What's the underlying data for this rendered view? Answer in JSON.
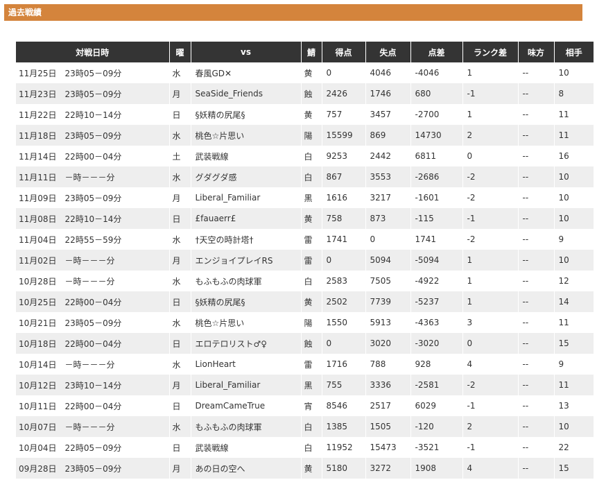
{
  "header": {
    "title": "過去戦績"
  },
  "columns": [
    "対戦日時",
    "曜",
    "vs",
    "鯖",
    "得点",
    "失点",
    "点差",
    "ランク差",
    "味方",
    "相手"
  ],
  "rows": [
    {
      "date": "11月25日",
      "time": "23時05－09分",
      "day": "水",
      "vs": "春風GD✕",
      "zoku": "黄",
      "score": "0",
      "lost": "4046",
      "diff": "-4046",
      "rank": "1",
      "mikata": "--",
      "aite": "10"
    },
    {
      "date": "11月23日",
      "time": "23時05－09分",
      "day": "月",
      "vs": "SeaSide_Friends",
      "zoku": "蝕",
      "score": "2426",
      "lost": "1746",
      "diff": "680",
      "rank": "-1",
      "mikata": "--",
      "aite": "8"
    },
    {
      "date": "11月22日",
      "time": "22時10－14分",
      "day": "日",
      "vs": "§妖精の尻尾§",
      "zoku": "黄",
      "score": "757",
      "lost": "3457",
      "diff": "-2700",
      "rank": "1",
      "mikata": "--",
      "aite": "11"
    },
    {
      "date": "11月18日",
      "time": "23時05－09分",
      "day": "水",
      "vs": "桃色☆片思い",
      "zoku": "陽",
      "score": "15599",
      "lost": "869",
      "diff": "14730",
      "rank": "2",
      "mikata": "--",
      "aite": "11"
    },
    {
      "date": "11月14日",
      "time": "22時00－04分",
      "day": "土",
      "vs": "武装戦線",
      "zoku": "白",
      "score": "9253",
      "lost": "2442",
      "diff": "6811",
      "rank": "0",
      "mikata": "--",
      "aite": "16"
    },
    {
      "date": "11月11日",
      "time": "－時－－－分",
      "day": "水",
      "vs": "グダグダ感",
      "zoku": "白",
      "score": "867",
      "lost": "3553",
      "diff": "-2686",
      "rank": "-2",
      "mikata": "--",
      "aite": "10"
    },
    {
      "date": "11月09日",
      "time": "23時05－09分",
      "day": "月",
      "vs": "Liberal_Familiar",
      "zoku": "黒",
      "score": "1616",
      "lost": "3217",
      "diff": "-1601",
      "rank": "-2",
      "mikata": "--",
      "aite": "10"
    },
    {
      "date": "11月08日",
      "time": "22時10－14分",
      "day": "日",
      "vs": "£fauaerr£",
      "zoku": "黄",
      "score": "758",
      "lost": "873",
      "diff": "-115",
      "rank": "-1",
      "mikata": "--",
      "aite": "10"
    },
    {
      "date": "11月04日",
      "time": "22時55－59分",
      "day": "水",
      "vs": "†天空の時計塔†",
      "zoku": "雷",
      "score": "1741",
      "lost": "0",
      "diff": "1741",
      "rank": "-2",
      "mikata": "--",
      "aite": "9"
    },
    {
      "date": "11月02日",
      "time": "－時－－－分",
      "day": "月",
      "vs": "エンジョイプレイRS",
      "zoku": "雷",
      "score": "0",
      "lost": "5094",
      "diff": "-5094",
      "rank": "1",
      "mikata": "--",
      "aite": "10"
    },
    {
      "date": "10月28日",
      "time": "－時－－－分",
      "day": "水",
      "vs": "もふもふの肉球軍",
      "zoku": "白",
      "score": "2583",
      "lost": "7505",
      "diff": "-4922",
      "rank": "1",
      "mikata": "--",
      "aite": "12"
    },
    {
      "date": "10月25日",
      "time": "22時00－04分",
      "day": "日",
      "vs": "§妖精の尻尾§",
      "zoku": "黄",
      "score": "2502",
      "lost": "7739",
      "diff": "-5237",
      "rank": "1",
      "mikata": "--",
      "aite": "14"
    },
    {
      "date": "10月21日",
      "time": "23時05－09分",
      "day": "水",
      "vs": "桃色☆片思い",
      "zoku": "陽",
      "score": "1550",
      "lost": "5913",
      "diff": "-4363",
      "rank": "3",
      "mikata": "--",
      "aite": "11"
    },
    {
      "date": "10月18日",
      "time": "22時00－04分",
      "day": "日",
      "vs": "エロテロリスト♂♀",
      "zoku": "蝕",
      "score": "0",
      "lost": "3020",
      "diff": "-3020",
      "rank": "0",
      "mikata": "--",
      "aite": "15"
    },
    {
      "date": "10月14日",
      "time": "－時－－－分",
      "day": "水",
      "vs": "LionHeart",
      "zoku": "雷",
      "score": "1716",
      "lost": "788",
      "diff": "928",
      "rank": "4",
      "mikata": "--",
      "aite": "9"
    },
    {
      "date": "10月12日",
      "time": "23時10－14分",
      "day": "月",
      "vs": "Liberal_Familiar",
      "zoku": "黒",
      "score": "755",
      "lost": "3336",
      "diff": "-2581",
      "rank": "-2",
      "mikata": "--",
      "aite": "11"
    },
    {
      "date": "10月11日",
      "time": "22時00－04分",
      "day": "日",
      "vs": "DreamCameTrue",
      "zoku": "宵",
      "score": "8546",
      "lost": "2517",
      "diff": "6029",
      "rank": "-1",
      "mikata": "--",
      "aite": "13"
    },
    {
      "date": "10月07日",
      "time": "－時－－－分",
      "day": "水",
      "vs": "もふもふの肉球軍",
      "zoku": "白",
      "score": "1385",
      "lost": "1505",
      "diff": "-120",
      "rank": "2",
      "mikata": "--",
      "aite": "10"
    },
    {
      "date": "10月04日",
      "time": "22時05－09分",
      "day": "日",
      "vs": "武装戦線",
      "zoku": "白",
      "score": "11952",
      "lost": "15473",
      "diff": "-3521",
      "rank": "-1",
      "mikata": "--",
      "aite": "22"
    },
    {
      "date": "09月28日",
      "time": "23時05－09分",
      "day": "月",
      "vs": "あの日の空へ",
      "zoku": "黄",
      "score": "5180",
      "lost": "3272",
      "diff": "1908",
      "rank": "4",
      "mikata": "--",
      "aite": "15"
    }
  ]
}
